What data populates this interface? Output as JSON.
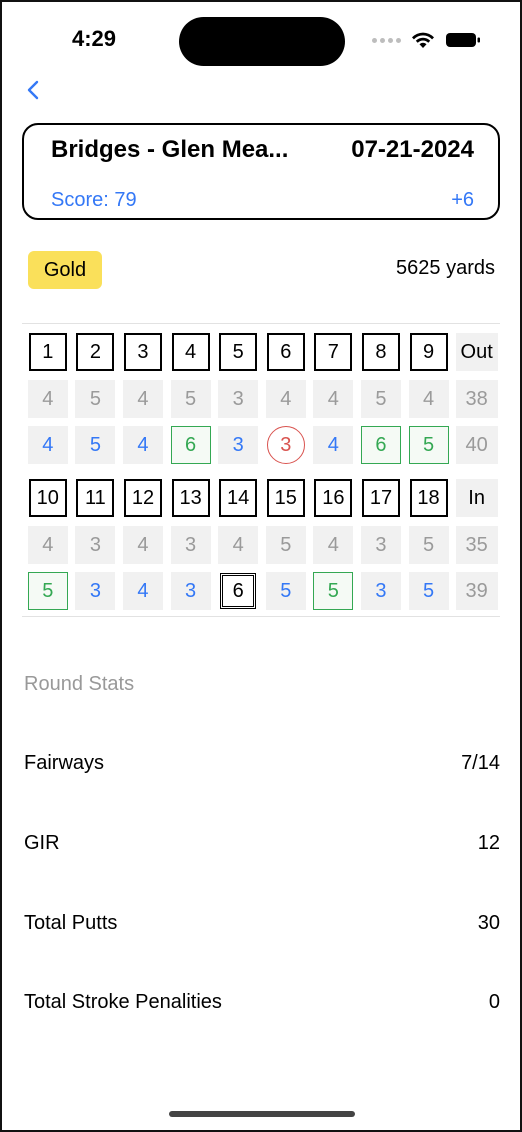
{
  "status": {
    "time": "4:29"
  },
  "header": {
    "course": "Bridges - Glen Mea...",
    "date": "07-21-2024",
    "score_label": "Score: 79",
    "to_par": "+6"
  },
  "tee": {
    "name": "Gold",
    "color": "#fae05a",
    "yards": "5625 yards"
  },
  "front": {
    "holes": [
      "1",
      "2",
      "3",
      "4",
      "5",
      "6",
      "7",
      "8",
      "9"
    ],
    "label": "Out",
    "par": [
      "4",
      "5",
      "4",
      "5",
      "3",
      "4",
      "4",
      "5",
      "4"
    ],
    "par_total": "38",
    "scores": [
      "4",
      "5",
      "4",
      "6",
      "3",
      "3",
      "4",
      "6",
      "5"
    ],
    "score_kinds": [
      "par",
      "par",
      "par",
      "bogey",
      "par",
      "birdie",
      "par",
      "bogey",
      "bogey"
    ],
    "score_total": "40"
  },
  "back": {
    "holes": [
      "10",
      "11",
      "12",
      "13",
      "14",
      "15",
      "16",
      "17",
      "18"
    ],
    "label": "In",
    "par": [
      "4",
      "3",
      "4",
      "3",
      "4",
      "5",
      "4",
      "3",
      "5"
    ],
    "par_total": "35",
    "scores": [
      "5",
      "3",
      "4",
      "3",
      "6",
      "5",
      "5",
      "3",
      "5"
    ],
    "score_kinds": [
      "bogey",
      "par",
      "par",
      "par",
      "double",
      "par",
      "bogey",
      "par",
      "par"
    ],
    "score_total": "39"
  },
  "stats": {
    "title": "Round Stats",
    "items": [
      {
        "label": "Fairways",
        "value": "7/14"
      },
      {
        "label": "GIR",
        "value": "12"
      },
      {
        "label": "Total Putts",
        "value": "30"
      },
      {
        "label": "Total Stroke Penalities",
        "value": "0"
      }
    ]
  },
  "colors": {
    "accent": "#3478f6",
    "bogey": "#34a853",
    "birdie": "#d9534f"
  }
}
